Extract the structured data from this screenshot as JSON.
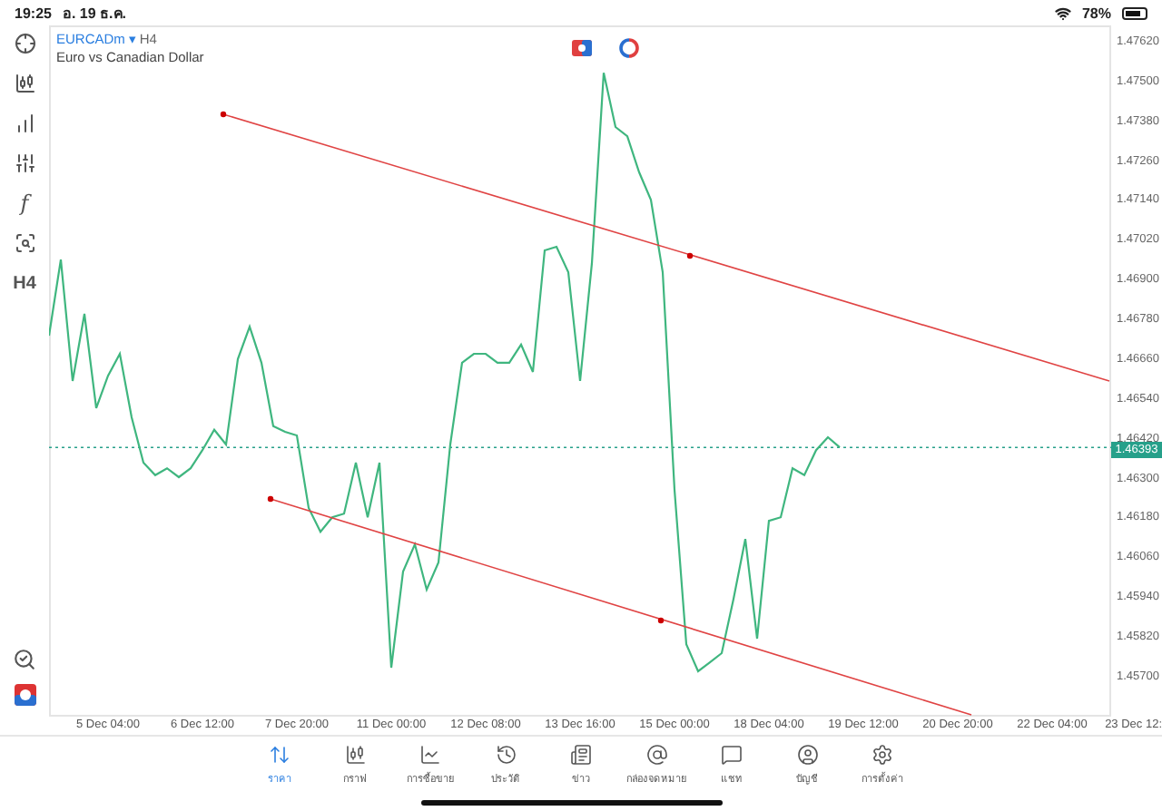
{
  "status_bar": {
    "time": "19:25",
    "date": "อ. 19 ธ.ค.",
    "battery": "78%"
  },
  "toolbar": [
    {
      "kind": "icon"
    },
    {
      "kind": "icon"
    },
    {
      "kind": "icon"
    },
    {
      "kind": "icon"
    },
    {
      "kind": "text",
      "label": "f"
    },
    {
      "kind": "icon"
    },
    {
      "kind": "text",
      "label": "H4"
    }
  ],
  "chart": {
    "caret": "▾",
    "timeframe": "H4",
    "description": "Euro vs Canadian Dollar",
    "current_price": "1.46393",
    "chart_data": {
      "type": "line",
      "ref_lines": [
        {
          "axis": "y",
          "value": 1.46393,
          "color": "#26a08a"
        }
      ],
      "ylim": [
        1.45579,
        1.47669
      ],
      "categories": [
        null,
        null,
        null,
        null,
        null,
        "5 Dec 04:00",
        null,
        null,
        null,
        null,
        null,
        null,
        null,
        "6 Dec 12:00",
        null,
        null,
        null,
        null,
        null,
        null,
        null,
        "7 Dec 20:00",
        null,
        null,
        null,
        null,
        null,
        null,
        null,
        "11 Dec 00:00",
        null,
        null,
        null,
        null,
        null,
        null,
        null,
        "12 Dec 08:00",
        null,
        null,
        null,
        null,
        null,
        null,
        null,
        "13 Dec 16:00",
        null,
        null,
        null,
        null,
        null,
        null,
        null,
        "15 Dec 00:00",
        null,
        null,
        null,
        null,
        null,
        null,
        null,
        "18 Dec 04:00",
        null,
        null,
        null,
        null,
        null,
        null,
        null,
        "19 Dec 12:00",
        null,
        null,
        null,
        null,
        null,
        null,
        null,
        "20 Dec 20:00",
        null,
        null,
        null,
        null,
        null,
        null,
        null,
        "22 Dec 04:00",
        null,
        null,
        null,
        null
      ],
      "series": [
        {
          "name": "EURCADm",
          "color": "#3fb67f",
          "values": [
            1.46731,
            1.46961,
            1.46594,
            1.46797,
            1.46512,
            1.4661,
            1.46676,
            1.46484,
            1.46347,
            1.46309,
            1.4633,
            1.46303,
            1.4633,
            1.46385,
            1.46446,
            1.46402,
            1.4666,
            1.46758,
            1.46649,
            1.46457,
            1.4644,
            1.46429,
            1.4621,
            1.46138,
            1.46182,
            1.46193,
            1.46347,
            1.46182,
            1.46347,
            1.45727,
            1.46018,
            1.461,
            1.45963,
            1.46045,
            1.46402,
            1.46649,
            1.46676,
            1.46676,
            1.46649,
            1.46649,
            1.46704,
            1.46621,
            1.46989,
            1.47,
            1.46923,
            1.46594,
            1.4695,
            1.47526,
            1.47362,
            1.47334,
            1.47225,
            1.47142,
            1.46923,
            1.46265,
            1.45798,
            1.45716,
            1.45743,
            1.45771,
            1.45935,
            1.46116,
            1.45815,
            1.46171,
            1.46182,
            1.4633,
            1.46309,
            1.46385,
            1.46424,
            1.46393,
            null,
            null,
            null,
            null,
            null,
            null,
            null,
            null,
            null,
            null,
            null,
            null,
            null,
            null,
            null,
            null,
            null,
            null,
            null,
            null,
            null,
            null
          ]
        }
      ],
      "yticks": [
        {
          "value": 1.4762,
          "label": "1.47620"
        },
        {
          "value": 1.475,
          "label": "1.47500"
        },
        {
          "value": 1.4738,
          "label": "1.47380"
        },
        {
          "value": 1.4726,
          "label": "1.47260"
        },
        {
          "value": 1.4714,
          "label": "1.47140"
        },
        {
          "value": 1.4702,
          "label": "1.47020"
        },
        {
          "value": 1.469,
          "label": "1.46900"
        },
        {
          "value": 1.4678,
          "label": "1.46780"
        },
        {
          "value": 1.4666,
          "label": "1.46660"
        },
        {
          "value": 1.4654,
          "label": "1.46540"
        },
        {
          "value": 1.4642,
          "label": "1.46420"
        },
        {
          "value": 1.463,
          "label": "1.46300"
        },
        {
          "value": 1.4618,
          "label": "1.46180"
        },
        {
          "value": 1.4606,
          "label": "1.46060"
        },
        {
          "value": 1.4594,
          "label": "1.45940"
        },
        {
          "value": 1.4582,
          "label": "1.45820"
        },
        {
          "value": 1.457,
          "label": "1.45700"
        }
      ]
    },
    "cut_time_label": "23 Dec 12:"
  },
  "tabs": [
    {
      "label": "ราคา",
      "selected": true
    },
    {
      "label": "กราฟ",
      "selected": false
    },
    {
      "label": "การซื้อขาย",
      "selected": false
    },
    {
      "label": "ประวัติ",
      "selected": false
    },
    {
      "label": "ข่าว",
      "selected": false
    },
    {
      "label": "กล่องจดหมาย",
      "selected": false
    },
    {
      "label": "แชท",
      "selected": false
    },
    {
      "label": "บัญชี",
      "selected": false
    },
    {
      "label": "การตั้งค่า",
      "selected": false
    }
  ]
}
